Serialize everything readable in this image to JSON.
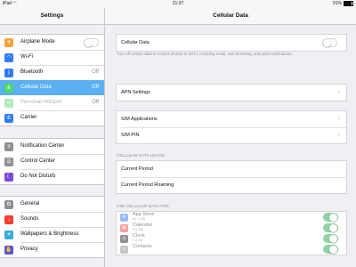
{
  "status": {
    "device": "iPad",
    "wifi_icon": "wifi-icon",
    "time": "21:37",
    "battery": "91%"
  },
  "sidebar": {
    "title": "Settings",
    "groups": [
      [
        {
          "label": "Airplane Mode",
          "icon": "airplane-icon",
          "color": "#f7a13a",
          "toggle": "off"
        },
        {
          "label": "Wi-Fi",
          "value": "",
          "icon": "wifi-icon",
          "color": "#2f7cf6"
        },
        {
          "label": "Bluetooth",
          "value": "Off",
          "icon": "bluetooth-icon",
          "color": "#2f7cf6"
        },
        {
          "label": "Cellular Data",
          "value": "Off",
          "icon": "cellular-icon",
          "color": "#4cd964",
          "selected": true
        },
        {
          "label": "Personal Hotspot",
          "value": "Off",
          "icon": "hotspot-icon",
          "color": "#4cd964",
          "dim": true
        },
        {
          "label": "Carrier",
          "icon": "phone-icon",
          "color": "#2f7cf6"
        }
      ],
      [
        {
          "label": "Notification Center",
          "icon": "notification-center-icon",
          "color": "#8e8e93"
        },
        {
          "label": "Control Center",
          "icon": "control-center-icon",
          "color": "#8e8e93"
        },
        {
          "label": "Do Not Disturb",
          "icon": "moon-icon",
          "color": "#7a4bd6"
        }
      ],
      [
        {
          "label": "General",
          "icon": "gear-icon",
          "color": "#8e8e93"
        },
        {
          "label": "Sounds",
          "icon": "speaker-icon",
          "color": "#ff3b30"
        },
        {
          "label": "Wallpapers & Brightness",
          "icon": "brightness-icon",
          "color": "#34aadc"
        },
        {
          "label": "Privacy",
          "icon": "hand-icon",
          "color": "#5856d6"
        }
      ]
    ]
  },
  "detail": {
    "title": "Cellular Data",
    "cellular_label": "Cellular Data",
    "cellular_note": "Turn off cellular data to restrict all data to Wi-Fi, including email, web browsing, and push notifications.",
    "apn": "APN Settings",
    "sim_apps": "SIM Applications",
    "sim_pin": "SIM PIN",
    "usage_header": "CELLULAR DATA USAGE",
    "current_period": "Current Period",
    "current_period_roaming": "Current Period Roaming",
    "apps_header": "USE CELLULAR DATA FOR:",
    "apps": [
      {
        "name": "App Store",
        "size": "60.1 MB",
        "icon": "app-store-icon",
        "color": "#2f7cf6"
      },
      {
        "name": "Calendar",
        "size": "9.6 MB",
        "icon": "calendar-icon",
        "color": "#ff3b30"
      },
      {
        "name": "Clock",
        "size": "7.8 KB",
        "icon": "clock-icon",
        "color": "#222222"
      },
      {
        "name": "Contacts",
        "size": "",
        "icon": "contacts-icon",
        "color": "#8e8e93"
      }
    ]
  }
}
